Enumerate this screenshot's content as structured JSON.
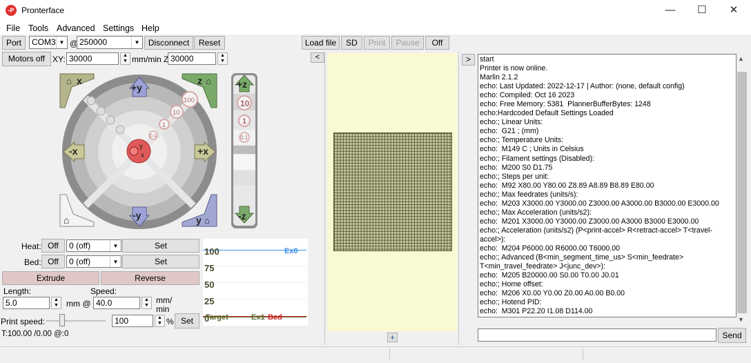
{
  "window": {
    "title": "Pronterface",
    "icon_text": "-P",
    "minimize": "—",
    "maximize": "☐",
    "close": "✕"
  },
  "menu": [
    "File",
    "Tools",
    "Advanced",
    "Settings",
    "Help"
  ],
  "toolbar": {
    "port_label": "Port",
    "port_value": "COM3",
    "at_label": "@",
    "baud_value": "250000",
    "disconnect_label": "Disconnect",
    "reset_label": "Reset",
    "load_file_label": "Load file",
    "sd_label": "SD",
    "print_label": "Print",
    "pause_label": "Pause",
    "off_label": "Off"
  },
  "motion": {
    "motors_off_label": "Motors off",
    "xy_label": "XY:",
    "xy_value": "30000",
    "z_label": "mm/min Z:",
    "z_value": "30000"
  },
  "jog": {
    "home_x": "x",
    "home_z": "z",
    "plus_y": "+y",
    "minus_y": "-y",
    "plus_x": "+x",
    "minus_x": "-x",
    "home_y": "y",
    "center_y": "y",
    "center_x": "x",
    "steps": [
      "100",
      "10",
      "1",
      "0.1"
    ],
    "plus_z": "+z",
    "minus_z": "-z",
    "z_steps": [
      "10",
      "1",
      "0.1"
    ]
  },
  "temperature": {
    "heat_label": "Heat:",
    "heat_off": "Off",
    "heat_value": "0 (off)",
    "heat_set": "Set",
    "bed_label": "Bed:",
    "bed_off": "Off",
    "bed_value": "0 (off)",
    "bed_set": "Set"
  },
  "extrude": {
    "extrude_label": "Extrude",
    "reverse_label": "Reverse",
    "length_label": "Length:",
    "length_value": "5.0",
    "mm_at_label": "mm @",
    "speed_label": "Speed:",
    "speed_value": "40.0",
    "speed_unit_1": "mm/",
    "speed_unit_2": "min",
    "print_speed_label": "Print speed:",
    "print_speed_value": "100",
    "percent_label": "%",
    "print_speed_set": "Set",
    "slider_level": 0.22,
    "temp_status": "T:100.00 /0.00 @:0"
  },
  "graph": {
    "y_ticks": [
      "100",
      "75",
      "50",
      "25",
      "0"
    ],
    "ex0_label": "Ex0",
    "target_label": "Target",
    "ex1_label": "Ex1",
    "bed_label": "Bed",
    "colors": {
      "ex0": "#3a8ee6",
      "bed": "#cc2222",
      "target": "#556b2f"
    }
  },
  "gcode_view": {
    "nav_left": "<",
    "add_label": "+"
  },
  "console": {
    "toggle_label": ">",
    "send_label": "Send",
    "input_value": "",
    "lines": [
      "start",
      "Printer is now online.",
      "Marlin 2.1.2",
      "echo: Last Updated: 2022-12-17 | Author: (none, default config)",
      "echo: Compiled: Oct 16 2023",
      "echo: Free Memory: 5381  PlannerBufferBytes: 1248",
      "echo:Hardcoded Default Settings Loaded",
      "echo:; Linear Units:",
      "echo:  G21 ; (mm)",
      "echo:; Temperature Units:",
      "echo:  M149 C ; Units in Celsius",
      "echo:; Filament settings (Disabled):",
      "echo:  M200 S0 D1.75",
      "echo:; Steps per unit:",
      "echo:  M92 X80.00 Y80.00 Z8.89 A8.89 B8.89 E80.00",
      "echo:; Max feedrates (units/s):",
      "echo:  M203 X3000.00 Y3000.00 Z3000.00 A3000.00 B3000.00 E3000.00",
      "echo:; Max Acceleration (units/s2):",
      "echo:  M201 X3000.00 Y3000.00 Z3000.00 A3000 B3000 E3000.00",
      "echo:; Acceleration (units/s2) (P<print-accel> R<retract-accel> T<travel-",
      "accel>):",
      "echo:  M204 P6000.00 R6000.00 T6000.00",
      "echo:; Advanced (B<min_segment_time_us> S<min_feedrate>",
      "T<min_travel_feedrate> J<junc_dev>):",
      "echo:  M205 B20000.00 S0.00 T0.00 J0.01",
      "echo:; Home offset:",
      "echo:  M206 X0.00 Y0.00 Z0.00 A0.00 B0.00",
      "echo:; Hotend PID:",
      "echo:  M301 P22.20 I1.08 D114.00"
    ]
  }
}
